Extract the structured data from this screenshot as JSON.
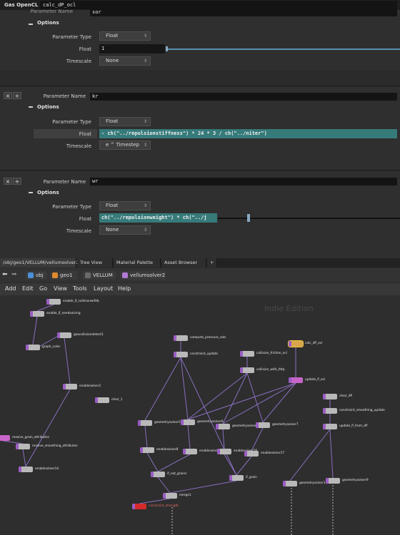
{
  "node_header": {
    "type_label": "Gas OpenCL",
    "node_name": "calc_dP_ocl"
  },
  "blocks": [
    {
      "param_name_label": "Parameter Name",
      "param_name_value": "sor",
      "options_label": "Options",
      "type_label": "Parameter Type",
      "type_value": "Float",
      "float_label": "Float",
      "float_value": "1",
      "timescale_label": "Timescale",
      "timescale_value": "None"
    },
    {
      "remove_symbol": "×",
      "add_symbol": "+",
      "param_name_label": "Parameter Name",
      "param_name_value": "kr",
      "options_label": "Options",
      "type_label": "Parameter Type",
      "type_value": "Float",
      "float_label": "Float",
      "float_value": "- ch(\"../repulsionstiffness\") * 24 * 3 / ch(\"../niter\")",
      "timescale_label": "Timescale",
      "timescale_value": "e ^ Timestep"
    },
    {
      "remove_symbol": "×",
      "add_symbol": "+",
      "param_name_label": "Parameter Name",
      "param_name_value": "wr",
      "options_label": "Options",
      "type_label": "Parameter Type",
      "type_value": "Float",
      "float_label": "Float",
      "float_value": "ch(\"../repulsionweight\") * ch(\"../j",
      "timescale_label": "Timescale",
      "timescale_value": "None"
    }
  ],
  "pane_tabs": [
    "/obj/geo1/VELLUM/vellumsolver2",
    "Tree View",
    "Material Palette",
    "Asset Browser",
    "+"
  ],
  "path_bar": {
    "items": [
      "obj",
      "geo1",
      "VELLUM",
      "vellumsolver2"
    ],
    "colors": {
      "obj": "#4a90d9",
      "geo1": "#e08a2c",
      "VELLUM": "#6a6a6a",
      "vellumsolver2": "#b07ad4"
    }
  },
  "menu": [
    "Add",
    "Edit",
    "Go",
    "View",
    "Tools",
    "Layout",
    "Help"
  ],
  "watermark": "Indie Edition",
  "nodes": [
    {
      "label": "enable_if_collisionwithb"
    },
    {
      "label": "enable_if_needsolving"
    },
    {
      "label": "geocollisiondetect1"
    },
    {
      "label": "graph_color"
    },
    {
      "label": "enablesolver1"
    },
    {
      "label": "clear_1"
    },
    {
      "label": "compute_pressure_vals"
    },
    {
      "label": "constraint_update"
    },
    {
      "label": "collision_friction_ocl"
    },
    {
      "label": "collision_with_http"
    },
    {
      "label": "calc_dP_ocl"
    },
    {
      "label": "update_P_ocl"
    },
    {
      "label": "clear_dP"
    },
    {
      "label": "constraint_smoothing_update"
    },
    {
      "label": "update_P_from_dP"
    },
    {
      "label": "geometrysolver5"
    },
    {
      "label": "geometrysolver6"
    },
    {
      "label": "geometrysolver8"
    },
    {
      "label": "geometrysolver7"
    },
    {
      "label": "enablesolver8"
    },
    {
      "label": "enablesolver6"
    },
    {
      "label": "enablesolver16"
    },
    {
      "label": "enablesolver17"
    },
    {
      "label": "if_not_grains"
    },
    {
      "label": "if_grain"
    },
    {
      "label": "merge1"
    },
    {
      "label": "geometrysolver11"
    },
    {
      "label": "geometrysolver9"
    },
    {
      "label": "resolve_grain_attributes"
    },
    {
      "label": "resolve_smoothing_attributes"
    },
    {
      "label": "enablesolver14"
    },
    {
      "label": "constraint_strength"
    }
  ]
}
